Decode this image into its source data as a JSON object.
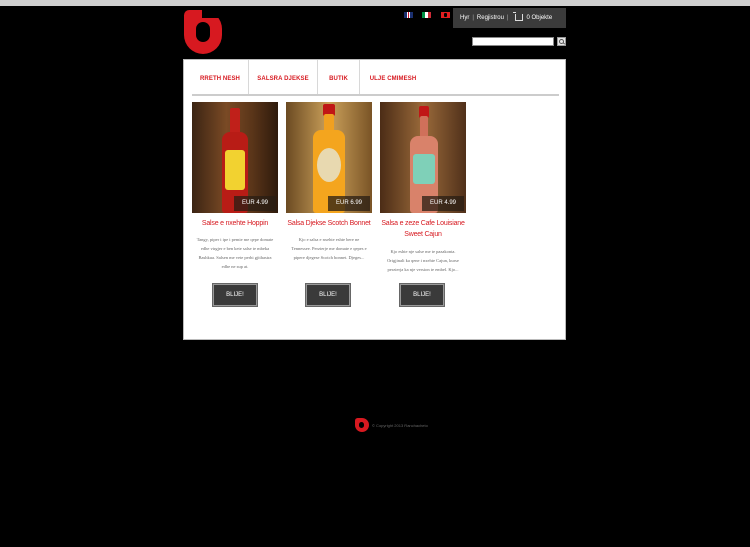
{
  "languages": [
    {
      "code": "en",
      "icon": "uk-flag-icon"
    },
    {
      "code": "it",
      "icon": "italy-flag-icon"
    },
    {
      "code": "sq",
      "icon": "albania-flag-icon"
    }
  ],
  "userbar": {
    "login": "Hyr",
    "register": "Regjistrou",
    "cart": "0 Objekte",
    "cart_icon": "cart-icon"
  },
  "search": {
    "placeholder": "",
    "button_icon": "search-icon"
  },
  "nav": [
    {
      "label": "RRETH NESH"
    },
    {
      "label": "SALSRA DJEKSE"
    },
    {
      "label": "BUTIK"
    },
    {
      "label": "ULJE CMIMESH"
    }
  ],
  "products": [
    {
      "title": "Salse e nxehte Hoppin",
      "price": "EUR 4.99",
      "description": "Tangy, piper i ipe i pemie me qepe domate edhe virgjer e ben kete salse te mbeka Bashkua. Salsen me vete perhi gjithastra edhe ne sup at.",
      "button": "BLIJE!"
    },
    {
      "title": "Salsa Djekse Scotch Bonnet",
      "price": "EUR 6.99",
      "description": "Kjo e salsa e nxehte eshte bere ne Tennessee. Perzierje me domate e qepes e pipere djegese Scotch bonnet. Djeges...",
      "button": "BLIJE!"
    },
    {
      "title": "Salsa e zeze Cafe Louisiane Sweet Cajun",
      "price": "EUR 4.99",
      "description": "Kjo eshte nje salse me te pazakonta. Origjinali ka qene i nxehte Cajun, kurse perzierja ka nje version te embel. Kjo...",
      "button": "BLIJE!"
    }
  ],
  "footer": {
    "copyright": "© Copyright 2013 Ranchacheto"
  },
  "colors": {
    "accent": "#d71920",
    "background": "#000000",
    "panel": "#ffffff",
    "userbar": "#3b3b3b"
  }
}
